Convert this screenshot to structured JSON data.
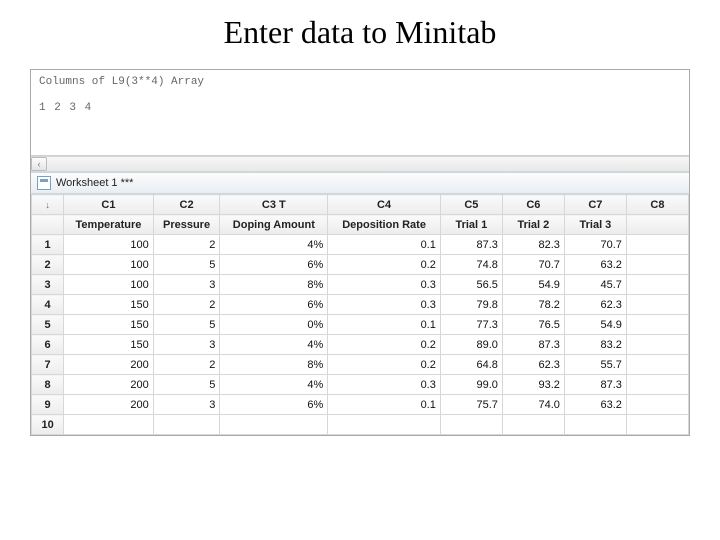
{
  "slide_title": "Enter data to Minitab",
  "session": {
    "line1": "Columns of L9(3**4) Array",
    "line2": "1 2 3 4"
  },
  "scroll": {
    "left": "‹",
    "right": ""
  },
  "worksheet": {
    "icon_name": "worksheet-icon",
    "title": "Worksheet 1 ***"
  },
  "corner_arrow": "↓",
  "col_labels": [
    "C1",
    "C2",
    "C3 T",
    "C4",
    "C5",
    "C6",
    "C7",
    "C8"
  ],
  "col_names": [
    "Temperature",
    "Pressure",
    "Doping Amount",
    "Deposition Rate",
    "Trial 1",
    "Trial 2",
    "Trial 3",
    ""
  ],
  "rows": [
    {
      "n": "1",
      "c": [
        "100",
        "2",
        "4%",
        "0.1",
        "87.3",
        "82.3",
        "70.7",
        ""
      ]
    },
    {
      "n": "2",
      "c": [
        "100",
        "5",
        "6%",
        "0.2",
        "74.8",
        "70.7",
        "63.2",
        ""
      ]
    },
    {
      "n": "3",
      "c": [
        "100",
        "3",
        "8%",
        "0.3",
        "56.5",
        "54.9",
        "45.7",
        ""
      ]
    },
    {
      "n": "4",
      "c": [
        "150",
        "2",
        "6%",
        "0.3",
        "79.8",
        "78.2",
        "62.3",
        ""
      ]
    },
    {
      "n": "5",
      "c": [
        "150",
        "5",
        "0%",
        "0.1",
        "77.3",
        "76.5",
        "54.9",
        ""
      ]
    },
    {
      "n": "6",
      "c": [
        "150",
        "3",
        "4%",
        "0.2",
        "89.0",
        "87.3",
        "83.2",
        ""
      ]
    },
    {
      "n": "7",
      "c": [
        "200",
        "2",
        "8%",
        "0.2",
        "64.8",
        "62.3",
        "55.7",
        ""
      ]
    },
    {
      "n": "8",
      "c": [
        "200",
        "5",
        "4%",
        "0.3",
        "99.0",
        "93.2",
        "87.3",
        ""
      ]
    },
    {
      "n": "9",
      "c": [
        "200",
        "3",
        "6%",
        "0.1",
        "75.7",
        "74.0",
        "63.2",
        ""
      ]
    },
    {
      "n": "10",
      "c": [
        "",
        "",
        "",
        "",
        "",
        "",
        "",
        ""
      ]
    }
  ]
}
